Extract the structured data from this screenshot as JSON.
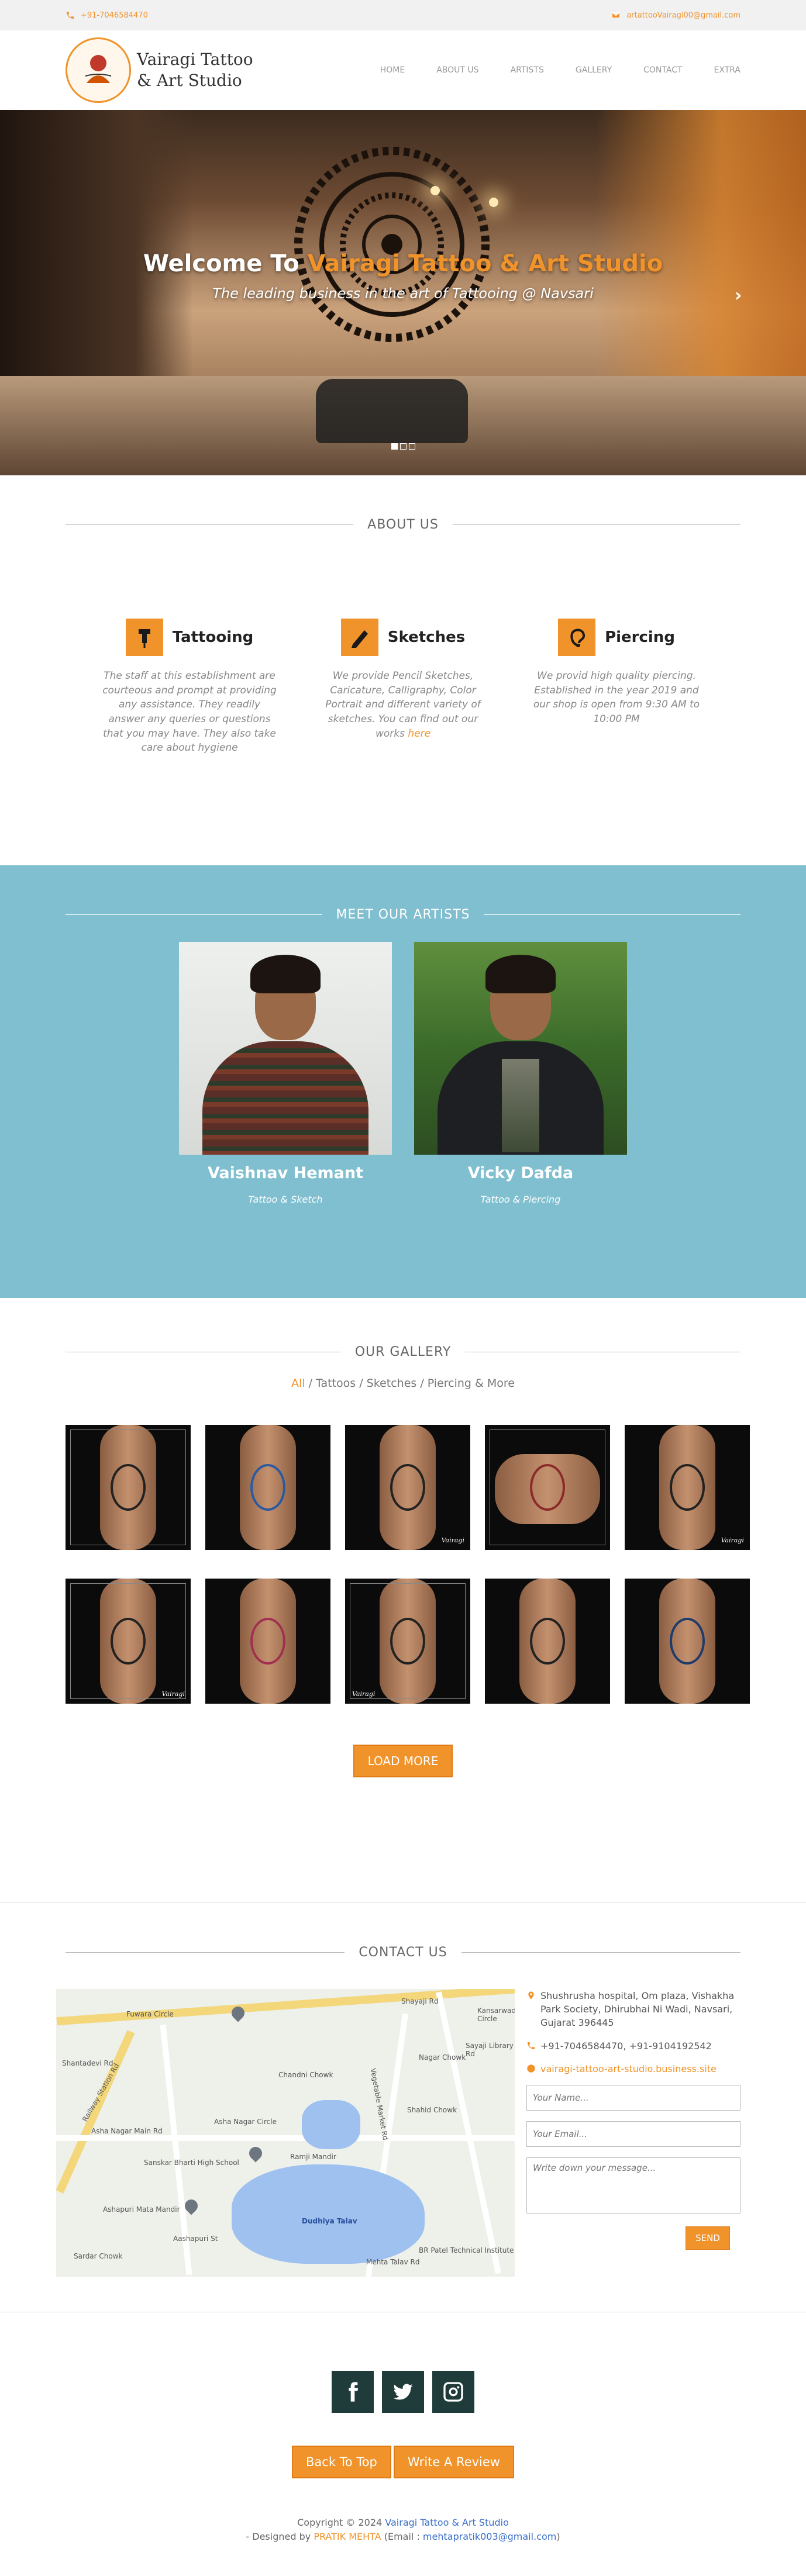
{
  "topbar": {
    "phone": "+91-7046584470",
    "email": "artattooVairagi00@gmail.com"
  },
  "brand": {
    "name": "Vairagi Tattoo & Art Studio"
  },
  "nav": [
    "HOME",
    "ABOUT US",
    "ARTISTS",
    "GALLERY",
    "CONTACT",
    "EXTRA"
  ],
  "hero": {
    "title_prefix": "Welcome To",
    "title_accent": "Vairagi Tattoo & Art Studio",
    "subtitle": "The leading business in the art of Tattooing @ Navsari",
    "next_arrow": "›"
  },
  "about": {
    "heading": "ABOUT US",
    "services": [
      {
        "title": "Tattooing",
        "text": "The staff at this establishment are courteous and prompt at providing any assistance. They readily answer any queries or questions that you may have. They also take care about hygiene"
      },
      {
        "title": "Sketches",
        "text": "We provide Pencil Sketches, Caricature, Calligraphy, Color Portrait and different variety of sketches. You can find out our works",
        "link": "here"
      },
      {
        "title": "Piercing",
        "text": "We provid high quality piercing. Established in the year 2019 and our shop is open from 9:30 AM to 10:00 PM"
      }
    ]
  },
  "artists": {
    "heading": "MEET OUR ARTISTS",
    "list": [
      {
        "name": "Vaishnav Hemant",
        "role": "Tattoo & Sketch"
      },
      {
        "name": "Vicky Dafda",
        "role": "Tattoo & Piercing"
      }
    ]
  },
  "gallery": {
    "heading": "OUR GALLERY",
    "filter_all": "All",
    "filter_rest": " / Tattoos / Sketches / Piercing & More",
    "watermark": "Vairagi",
    "load_more": "LOAD MORE"
  },
  "contact": {
    "heading": "CONTACT US",
    "address": "Shushrusha hospital, Om plaza, Vishakha Park Society, Dhirubhai Ni Wadi, Navsari, Gujarat 396445",
    "phones": "+91-7046584470, +91-9104192542",
    "website": "vairagi-tattoo-art-studio.business.site",
    "name_placeholder": "Your Name...",
    "email_placeholder": "Your Email...",
    "message_placeholder": "Write down your message...",
    "send": "SEND",
    "map_labels": [
      "Shayaji Rd",
      "Fuwara Circle",
      "Shantadevi Rd",
      "Railway Station Rd",
      "Asha Nagar Main Rd",
      "Sanskar Bharti High School",
      "Ashapuri Mata Mandir",
      "Sardar Chowk",
      "Aashapuri St",
      "Chandni Chowk",
      "Ramji Mandir",
      "Dudhiya Talav",
      "Shahid Chowk",
      "BR Patel Technical Institute",
      "Kansarwad Circle",
      "Sayaji Library Rd",
      "Nagar Chowk",
      "Asha Nagar Circle",
      "Vegetable Market Rd",
      "Mehta Talav Rd"
    ]
  },
  "footer": {
    "back_to_top": "Back To Top",
    "write_review": "Write A Review",
    "copyright": "Copyright © 2024",
    "copyright_link": "Vairagi Tattoo & Art Studio",
    "designed_by": "- Designed by",
    "designer": "PRATIK MEHTA",
    "email_label": "(Email :",
    "designer_email": "mehtapratik003@gmail.com",
    "email_close": ")"
  },
  "colors": {
    "accent": "#f0932b",
    "artists_bg": "#7fbfcf",
    "social_bg": "#1f3b3a",
    "link_blue": "#3a6fc7"
  }
}
